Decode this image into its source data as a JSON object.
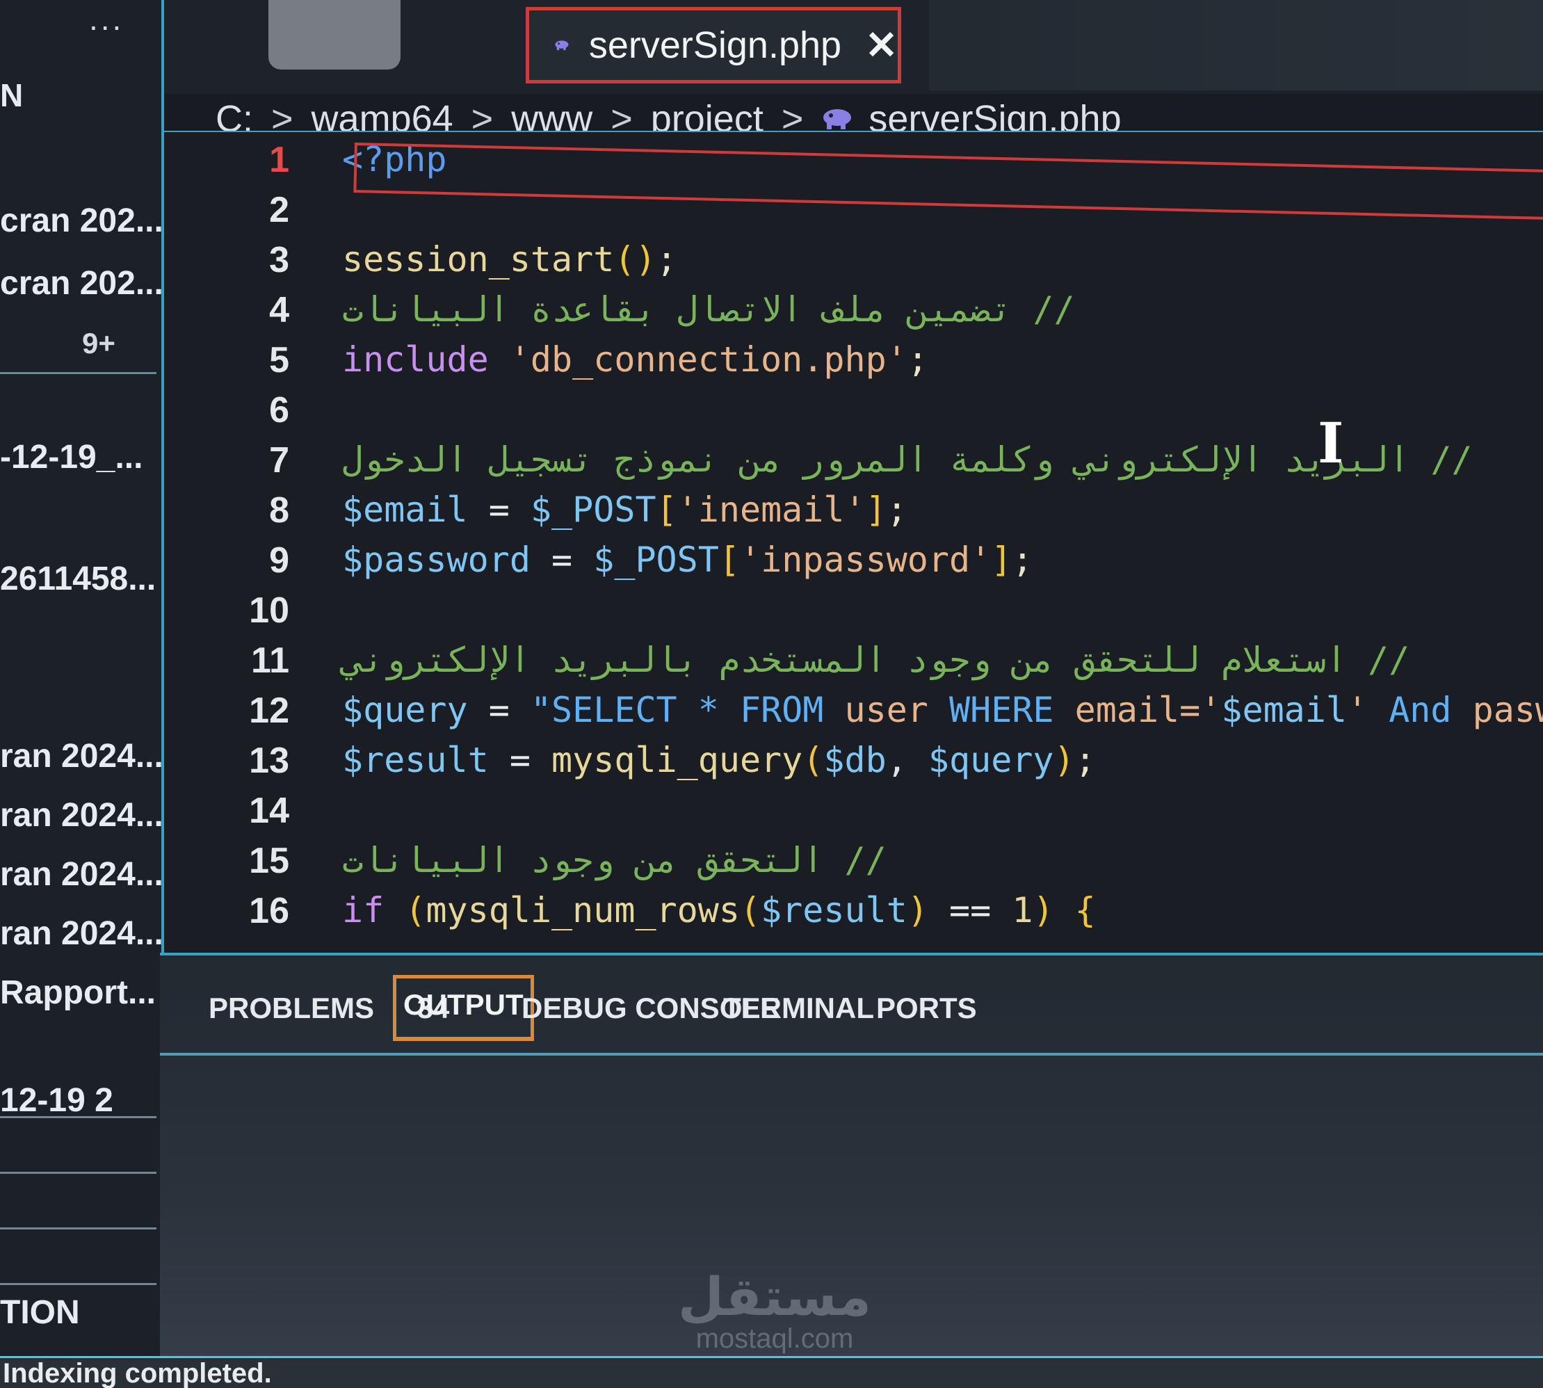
{
  "explorer": {
    "more_label": "...",
    "section_letter": "N",
    "items": [
      "cran 202...",
      "cran 202...",
      "-12-19_...",
      "2611458...",
      "ran 2024...",
      "ran 2024...",
      "ran 2024...",
      "ran 2024...",
      "Rapport...",
      "12-19 2",
      "TION"
    ],
    "badge": "9+"
  },
  "tabs": {
    "active": {
      "title": "serverSign.php",
      "close_glyph": "✕",
      "icon": "php-elephant-icon"
    }
  },
  "breadcrumb": {
    "parts": [
      "C:",
      "wamp64",
      "www",
      "project"
    ],
    "file": "serverSign.php",
    "separator": ">"
  },
  "editor": {
    "active_line": 1,
    "lines": [
      {
        "n": "1",
        "tokens": [
          {
            "t": "<?php",
            "c": "tag"
          }
        ]
      },
      {
        "n": "2",
        "tokens": []
      },
      {
        "n": "3",
        "tokens": [
          {
            "t": "session_start",
            "c": "fn"
          },
          {
            "t": "()",
            "c": "paren"
          },
          {
            "t": ";",
            "c": "punc"
          }
        ]
      },
      {
        "n": "4",
        "tokens": [
          {
            "t": "// تضمين ملف الاتصال بقاعدة البيانات",
            "c": "cmt"
          }
        ]
      },
      {
        "n": "5",
        "tokens": [
          {
            "t": "include",
            "c": "kw"
          },
          {
            "t": " ",
            "c": "plain"
          },
          {
            "t": "'db_connection.php'",
            "c": "str"
          },
          {
            "t": ";",
            "c": "punc"
          }
        ]
      },
      {
        "n": "6",
        "tokens": []
      },
      {
        "n": "7",
        "tokens": [
          {
            "t": "// البريد الإلكتروني وكلمة المرور من نموذج تسجيل الدخول",
            "c": "cmt"
          }
        ]
      },
      {
        "n": "8",
        "tokens": [
          {
            "t": "$email",
            "c": "var"
          },
          {
            "t": " = ",
            "c": "op"
          },
          {
            "t": "$_POST",
            "c": "var"
          },
          {
            "t": "[",
            "c": "paren"
          },
          {
            "t": "'inemail'",
            "c": "str"
          },
          {
            "t": "]",
            "c": "paren"
          },
          {
            "t": ";",
            "c": "punc"
          }
        ]
      },
      {
        "n": "9",
        "tokens": [
          {
            "t": "$password",
            "c": "var"
          },
          {
            "t": " = ",
            "c": "op"
          },
          {
            "t": "$_POST",
            "c": "var"
          },
          {
            "t": "[",
            "c": "paren"
          },
          {
            "t": "'inpassword'",
            "c": "str"
          },
          {
            "t": "]",
            "c": "paren"
          },
          {
            "t": ";",
            "c": "punc"
          }
        ]
      },
      {
        "n": "10",
        "tokens": []
      },
      {
        "n": "11",
        "tokens": [
          {
            "t": "// استعلام للتحقق من وجود المستخدم بالبريد الإلكتروني",
            "c": "cmt"
          }
        ]
      },
      {
        "n": "12",
        "tokens": [
          {
            "t": "$query",
            "c": "var"
          },
          {
            "t": " = ",
            "c": "op"
          },
          {
            "t": "\"SELECT * ",
            "c": "sql"
          },
          {
            "t": "FROM",
            "c": "sql"
          },
          {
            "t": " user ",
            "c": "str"
          },
          {
            "t": "WHERE",
            "c": "sql"
          },
          {
            "t": " email='",
            "c": "str"
          },
          {
            "t": "$email",
            "c": "var"
          },
          {
            "t": "' ",
            "c": "str"
          },
          {
            "t": "And",
            "c": "sql"
          },
          {
            "t": " paswo",
            "c": "str"
          }
        ]
      },
      {
        "n": "13",
        "tokens": [
          {
            "t": "$result",
            "c": "var"
          },
          {
            "t": " = ",
            "c": "op"
          },
          {
            "t": "mysqli_query",
            "c": "fn"
          },
          {
            "t": "(",
            "c": "paren"
          },
          {
            "t": "$db",
            "c": "var"
          },
          {
            "t": ", ",
            "c": "plain"
          },
          {
            "t": "$query",
            "c": "var"
          },
          {
            "t": ")",
            "c": "paren"
          },
          {
            "t": ";",
            "c": "punc"
          }
        ]
      },
      {
        "n": "14",
        "tokens": []
      },
      {
        "n": "15",
        "tokens": [
          {
            "t": "// التحقق من وجود البيانات",
            "c": "cmt"
          }
        ]
      },
      {
        "n": "16",
        "tokens": [
          {
            "t": "if",
            "c": "kw"
          },
          {
            "t": " (",
            "c": "paren"
          },
          {
            "t": "mysqli_num_rows",
            "c": "fn"
          },
          {
            "t": "(",
            "c": "paren"
          },
          {
            "t": "$result",
            "c": "var"
          },
          {
            "t": ")",
            "c": "paren"
          },
          {
            "t": " == ",
            "c": "op"
          },
          {
            "t": "1",
            "c": "fn"
          },
          {
            "t": ") {",
            "c": "paren"
          }
        ]
      }
    ]
  },
  "panel": {
    "tabs": [
      {
        "label": "PROBLEMS",
        "count": "34",
        "active": false
      },
      {
        "label": "OUTPUT",
        "active": true
      },
      {
        "label": "DEBUG CONSOLE",
        "active": false
      },
      {
        "label": "TERMINAL",
        "active": false
      },
      {
        "label": "PORTS",
        "active": false
      }
    ]
  },
  "watermark": {
    "logo": "مستقل",
    "url": "mostaql.com"
  },
  "status": {
    "text": "Indexing completed."
  },
  "colors": {
    "accent": "#3aa0c8",
    "highlight_red": "#d03a3a",
    "highlight_orange": "#d9893a"
  }
}
